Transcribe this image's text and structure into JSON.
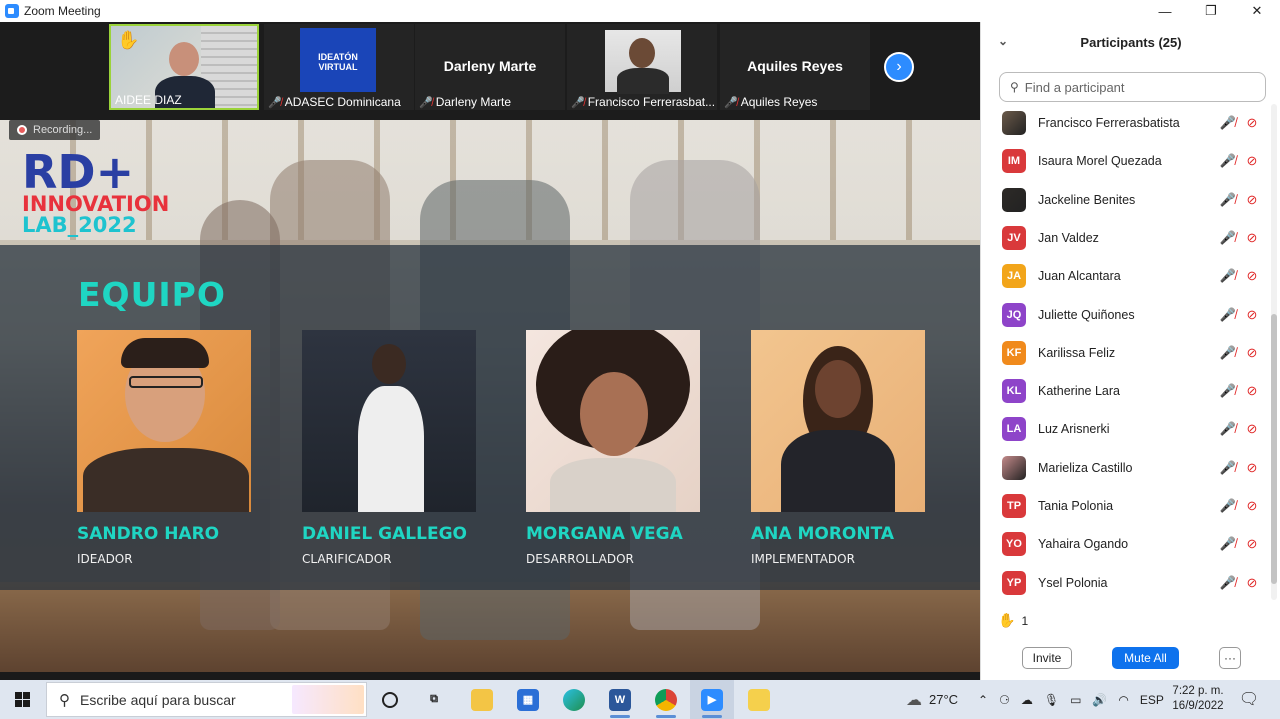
{
  "window": {
    "title": "Zoom Meeting",
    "controls": [
      "—",
      "❐",
      "✕"
    ]
  },
  "gallery": {
    "tiles": [
      {
        "name": "AIDEE DIAZ",
        "hand_raised": true,
        "muted": false,
        "has_video": true
      },
      {
        "name": "ADASEC Dominicana",
        "muted": true,
        "has_video": true,
        "logo_text": "IDEATÓN VIRTUAL"
      },
      {
        "name": "Darleny Marte",
        "muted": true,
        "has_video": false,
        "display": "Darleny Marte"
      },
      {
        "name": "Francisco Ferrerasbat...",
        "muted": true,
        "has_video": true
      },
      {
        "name": "Aquiles Reyes",
        "muted": true,
        "has_video": false,
        "display": "Aquiles Reyes"
      }
    ],
    "next_icon": "chevron-right-icon"
  },
  "share": {
    "recording_label": "Recording...",
    "logo": {
      "line1": "RD+",
      "line2": "INNOVATION",
      "line3": "LAB_2022"
    },
    "heading": "EQUIPO",
    "members": [
      {
        "name": "SANDRO HARO",
        "role": "IDEADOR"
      },
      {
        "name": "DANIEL GALLEGO",
        "role": "CLARIFICADOR"
      },
      {
        "name": "MORGANA VEGA",
        "role": "DESARROLLADOR"
      },
      {
        "name": "ANA MORONTA",
        "role": "IMPLEMENTADOR"
      }
    ]
  },
  "participants": {
    "title": "Participants (25)",
    "search_placeholder": "Find a participant",
    "list": [
      {
        "initials": "",
        "name": "Francisco Ferrerasbatista",
        "color": "#6b5a4a",
        "photo": true
      },
      {
        "initials": "IM",
        "name": "Isaura Morel Quezada",
        "color": "#d9393b",
        "photo": false
      },
      {
        "initials": "",
        "name": "Jackeline Benites",
        "color": "#2d2a27",
        "photo": true
      },
      {
        "initials": "JV",
        "name": "Jan Valdez",
        "color": "#d9393b",
        "photo": false
      },
      {
        "initials": "JA",
        "name": "Juan Alcantara",
        "color": "#f2a51a",
        "photo": false
      },
      {
        "initials": "JQ",
        "name": "Juliette Quiñones",
        "color": "#8e44c9",
        "photo": false
      },
      {
        "initials": "KF",
        "name": "Karilissa Feliz",
        "color": "#f08a1c",
        "photo": false
      },
      {
        "initials": "KL",
        "name": "Katherine Lara",
        "color": "#8e44c9",
        "photo": false
      },
      {
        "initials": "LA",
        "name": "Luz Arisnerki",
        "color": "#8e44c9",
        "photo": false
      },
      {
        "initials": "",
        "name": "Marieliza Castillo",
        "color": "#c48a8a",
        "photo": true
      },
      {
        "initials": "TP",
        "name": "Tania Polonia",
        "color": "#d9393b",
        "photo": false
      },
      {
        "initials": "YO",
        "name": "Yahaira Ogando",
        "color": "#d9393b",
        "photo": false
      },
      {
        "initials": "YP",
        "name": "Ysel Polonia",
        "color": "#d9393b",
        "photo": false
      }
    ],
    "raised_hands_count": "1",
    "invite_label": "Invite",
    "mute_all_label": "Mute All",
    "more_label": "···"
  },
  "taskbar": {
    "search_placeholder": "Escribe aquí para buscar",
    "apps": [
      "cortana-icon",
      "task-view-icon",
      "file-explorer-icon",
      "store-icon",
      "edge-icon",
      "word-icon",
      "chrome-icon",
      "zoom-icon",
      "sticky-notes-icon"
    ],
    "temperature": "27°C",
    "language": "ESP",
    "time": "7:22 p. m.",
    "date": "16/9/2022"
  }
}
